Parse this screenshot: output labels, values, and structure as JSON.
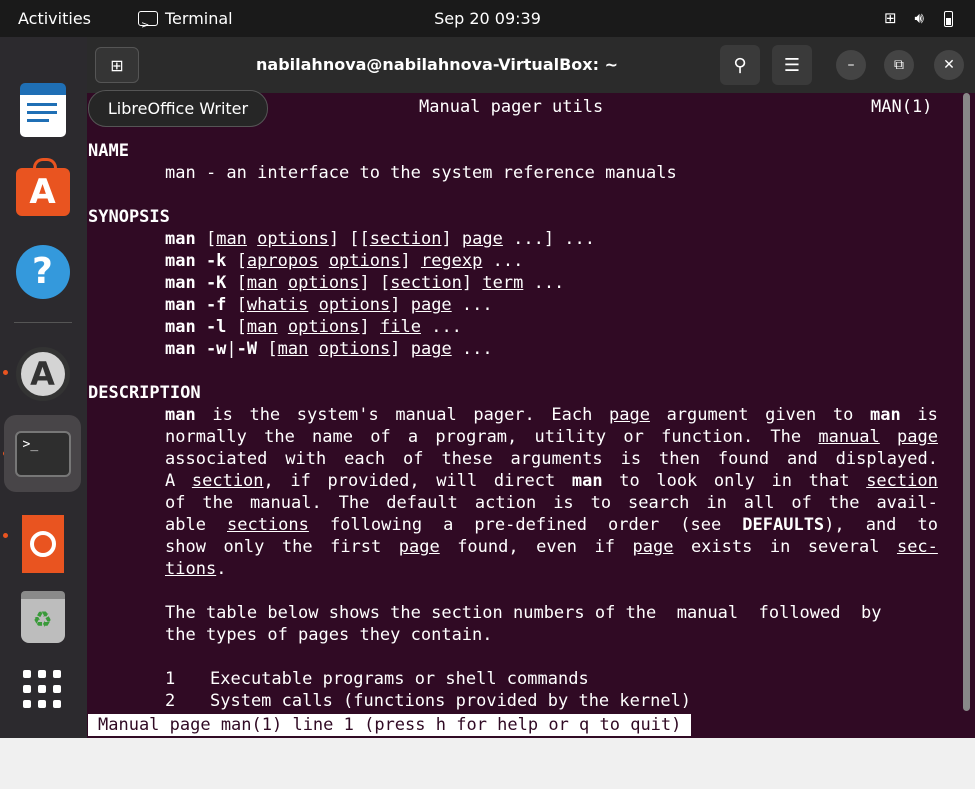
{
  "topbar": {
    "activities": "Activities",
    "app_name": "Terminal",
    "clock": "Sep 20  09:39",
    "icons": [
      "network-icon",
      "volume-icon",
      "battery-icon"
    ]
  },
  "dock": {
    "items": [
      {
        "name": "LibreOffice Writer",
        "icon": "writer-icon"
      },
      {
        "name": "Ubuntu Software",
        "icon": "software-store-icon"
      },
      {
        "name": "Help",
        "icon": "help-icon",
        "glyph": "?"
      },
      {
        "name": "Software Updater",
        "icon": "updater-icon",
        "glyph": "A"
      },
      {
        "name": "Terminal",
        "icon": "terminal-icon",
        "glyph": ">_"
      },
      {
        "name": "Ubuntu",
        "icon": "ubuntu-icon"
      },
      {
        "name": "Trash",
        "icon": "trash-icon",
        "glyph": "♻"
      },
      {
        "name": "Show Applications",
        "icon": "app-grid-icon"
      }
    ]
  },
  "window": {
    "title": "nabilahnova@nabilahnova-VirtualBox: ~",
    "tooltip": "LibreOffice Writer"
  },
  "man": {
    "header_center": "Manual pager utils",
    "header_right": "MAN(1)",
    "name_heading": "NAME",
    "name_text": "man - an interface to the system reference manuals",
    "synopsis_heading": "SYNOPSIS",
    "description_heading": "DESCRIPTION",
    "table_intro_1": "The table below shows the section numbers of the  manual  followed  by",
    "table_intro_2": "the types of pages they contain.",
    "sections": [
      {
        "num": "1",
        "text": "Executable programs or shell commands"
      },
      {
        "num": "2",
        "text": "System calls (functions provided by the kernel)"
      }
    ],
    "status": "Manual page man(1) line 1 (press h for help or q to quit)"
  },
  "colors": {
    "terminal_bg": "#300a24",
    "accent": "#e95420",
    "topbar": "#1a1a1a"
  }
}
